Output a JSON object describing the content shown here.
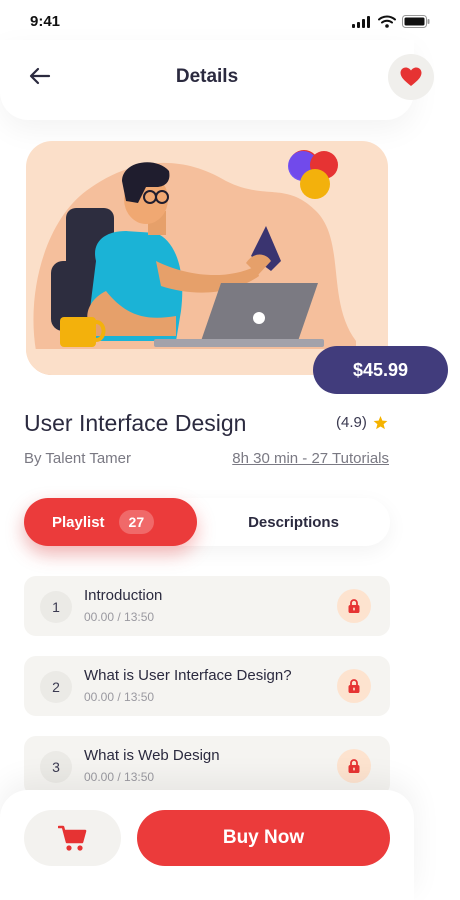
{
  "status_bar": {
    "time": "9:41"
  },
  "header": {
    "title": "Details"
  },
  "course": {
    "price": "$45.99",
    "title": "User Interface Design",
    "rating": "(4.9)",
    "author": "By Talent Tamer",
    "duration": "8h 30 min - 27 Tutorials"
  },
  "tabs": {
    "playlist_label": "Playlist",
    "playlist_count": "27",
    "descriptions_label": "Descriptions"
  },
  "lessons": [
    {
      "number": "1",
      "title": "Introduction",
      "time": "00.00 / 13:50"
    },
    {
      "number": "2",
      "title": "What is User Interface Design?",
      "time": "00.00 / 13:50"
    },
    {
      "number": "3",
      "title": "What is Web Design",
      "time": "00.00 / 13:50"
    }
  ],
  "bottom": {
    "buy_label": "Buy Now"
  },
  "icons": {
    "back": "arrow-left-icon",
    "favorite": "heart-icon",
    "star": "star-icon",
    "lock": "lock-icon",
    "cart": "cart-icon"
  },
  "colors": {
    "accent_red": "#eb3b3b",
    "price_bg": "#413c7c",
    "hero_bg": "#fbdfc9",
    "star": "#f5b300"
  }
}
